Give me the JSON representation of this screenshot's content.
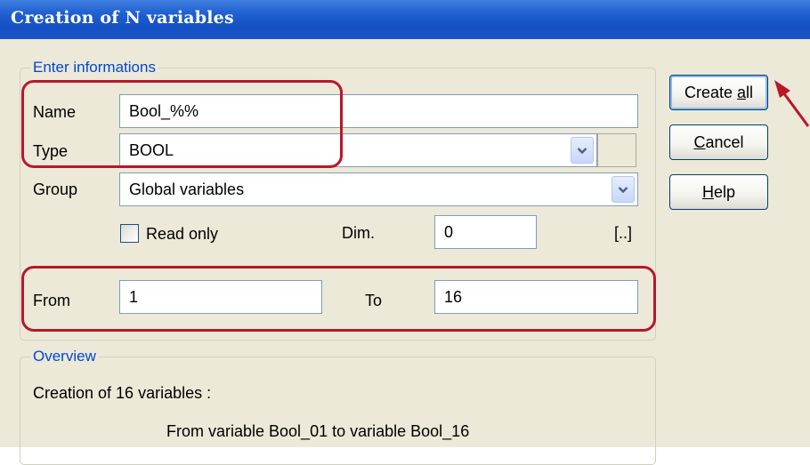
{
  "window": {
    "title": "Creation of N variables"
  },
  "enter_group": {
    "legend": "Enter informations",
    "name_label": "Name",
    "name_value": "Bool_%%",
    "type_label": "Type",
    "type_value": "BOOL",
    "group_label": "Group",
    "group_value": "Global variables",
    "read_only_label": "Read only",
    "read_only_checked": false,
    "dim_label": "Dim.",
    "dim_value": "0",
    "dim_button": "[..]",
    "from_label": "From",
    "from_value": "1",
    "to_label": "To",
    "to_value": "16"
  },
  "overview_group": {
    "legend": "Overview",
    "line1": "Creation of 16 variables :",
    "line2": "From variable Bool_01 to variable Bool_16"
  },
  "buttons": {
    "create_all_pre": "Create ",
    "create_all_mnemonic": "a",
    "create_all_post": "ll",
    "cancel_mnemonic": "C",
    "cancel_post": "ancel",
    "help_mnemonic": "H",
    "help_post": "elp"
  },
  "colors": {
    "title_bar": "#1f5fd0",
    "dialog_bg": "#ece9d8",
    "legend_text": "#0046d5",
    "annotation": "#b8172b"
  },
  "icons": [
    "dropdown-arrow-icon",
    "annotation-arrow-icon"
  ]
}
